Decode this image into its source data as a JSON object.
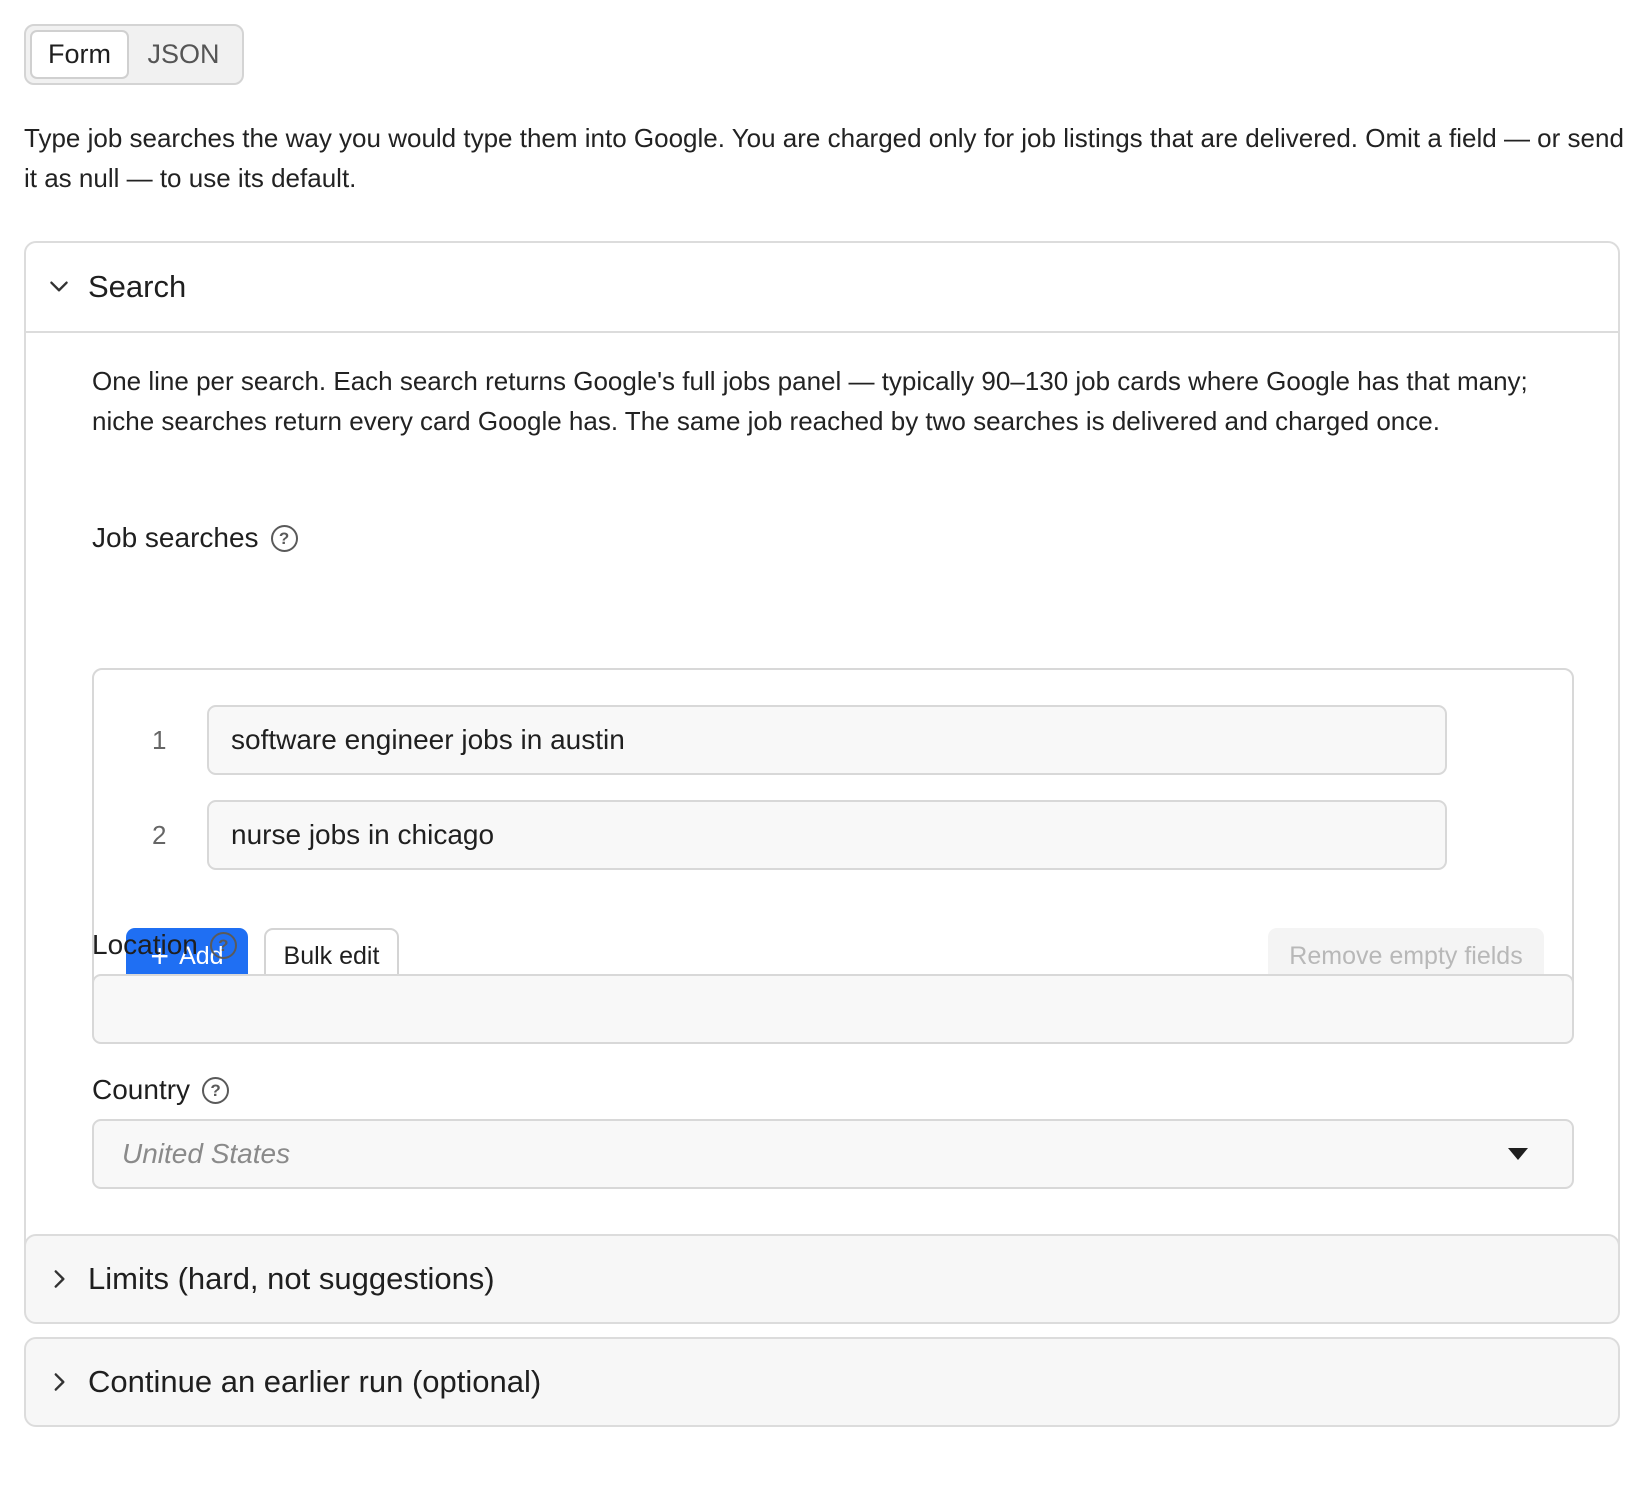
{
  "mode_switch": {
    "form_label": "Form",
    "json_label": "JSON",
    "active": "Form"
  },
  "intro_text": "Type job searches the way you would type them into Google. You are charged only for job listings that are delivered. Omit a field — or send it as null — to use its default.",
  "search_section": {
    "title": "Search",
    "expanded": true,
    "description": "One line per search. Each search returns Google's full jobs panel — typically 90–130 job cards where Google has that many; niche searches return every card Google has. The same job reached by two searches is delivered and charged once.",
    "job_searches": {
      "label": "Job searches",
      "rows": [
        {
          "index": "1",
          "value": "software engineer jobs in austin"
        },
        {
          "index": "2",
          "value": "nurse jobs in chicago"
        }
      ],
      "add_label": "Add",
      "bulk_edit_label": "Bulk edit",
      "remove_empty_label": "Remove empty fields"
    },
    "location": {
      "label": "Location",
      "value": "",
      "placeholder": ""
    },
    "country": {
      "label": "Country",
      "placeholder": "United States"
    }
  },
  "limits_section": {
    "title": "Limits (hard, not suggestions)",
    "expanded": false
  },
  "continue_section": {
    "title": "Continue an earlier run (optional)",
    "expanded": false
  },
  "colors": {
    "accent": "#1f6ff3",
    "border": "#d8d8d8",
    "input_bg": "#f8f8f8",
    "disabled_text": "#b8b8b8"
  }
}
